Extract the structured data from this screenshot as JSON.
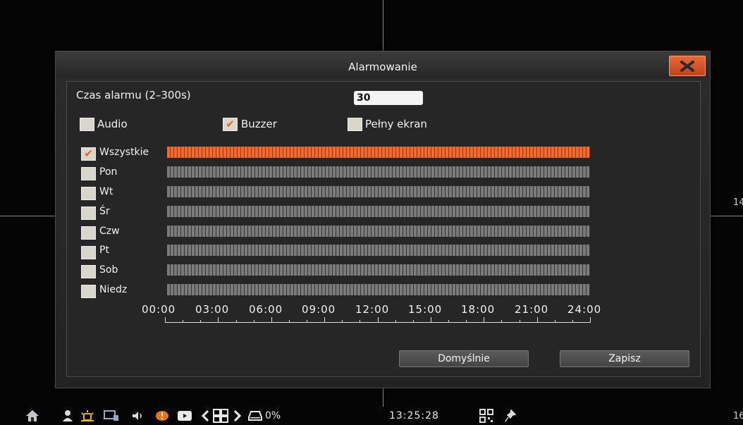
{
  "dialog": {
    "title": "Alarmowanie",
    "alarm_time_label": "Czas alarmu (2–300s)",
    "alarm_time_value": "30",
    "options": [
      {
        "label": "Audio",
        "checked": false
      },
      {
        "label": "Buzzer",
        "checked": true
      },
      {
        "label": "Pełny ekran",
        "checked": false
      }
    ],
    "schedule": {
      "days": [
        {
          "label": "Wszystkie",
          "checked": true,
          "active": true
        },
        {
          "label": "Pon",
          "checked": false,
          "active": false
        },
        {
          "label": "Wt",
          "checked": false,
          "active": false
        },
        {
          "label": "Śr",
          "checked": false,
          "active": false
        },
        {
          "label": "Czw",
          "checked": false,
          "active": false
        },
        {
          "label": "Pt",
          "checked": false,
          "active": false
        },
        {
          "label": "Sob",
          "checked": false,
          "active": false
        },
        {
          "label": "Niedz",
          "checked": false,
          "active": false
        }
      ],
      "time_labels": [
        "00:00",
        "03:00",
        "06:00",
        "09:00",
        "12:00",
        "15:00",
        "18:00",
        "21:00",
        "24:00"
      ]
    },
    "buttons": {
      "default": "Domyślnie",
      "save": "Zapisz"
    }
  },
  "background": {
    "channel_right_top": "14",
    "channel_right_bottom": "16"
  },
  "taskbar": {
    "icons": [
      "home-icon",
      "user-icon",
      "alarm-icon",
      "monitor-icon",
      "speaker-icon",
      "notification-icon",
      "playback-icon",
      "prev-arrow-icon",
      "grid-layout-icon",
      "next-arrow-icon",
      "hdd-icon",
      "qr-code-icon",
      "pin-icon"
    ],
    "hdd_usage": "0%",
    "clock": "13:25:28"
  },
  "colors": {
    "accent": "#ef6a2c",
    "close_button": "#d9532a",
    "inactive_schedule": "#7b7b7b"
  }
}
